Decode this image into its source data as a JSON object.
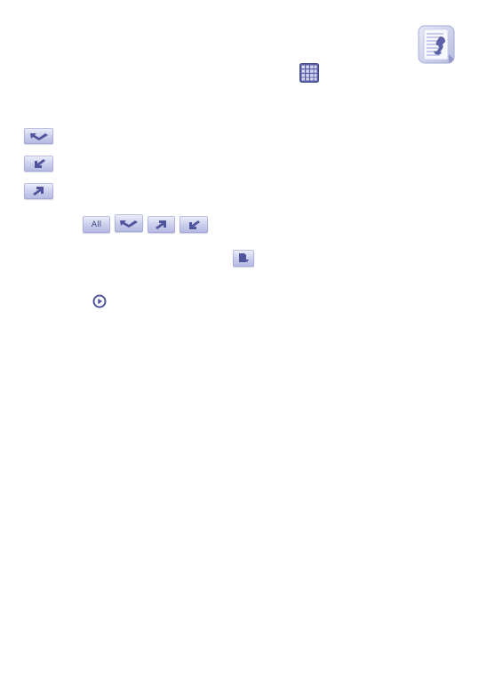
{
  "page": {
    "background": "#ffffff",
    "accent": "#5b60a8"
  },
  "icons": {
    "call_log_app": "call-log-app-icon",
    "app_grid": "app-grid-icon",
    "missed_call": "missed-call-icon",
    "incoming_call": "incoming-call-icon",
    "outgoing_call": "outgoing-call-icon",
    "save_to_sim": "save-to-sim-icon",
    "play": "play-icon"
  },
  "filter_tabs": {
    "all_label": "All"
  }
}
